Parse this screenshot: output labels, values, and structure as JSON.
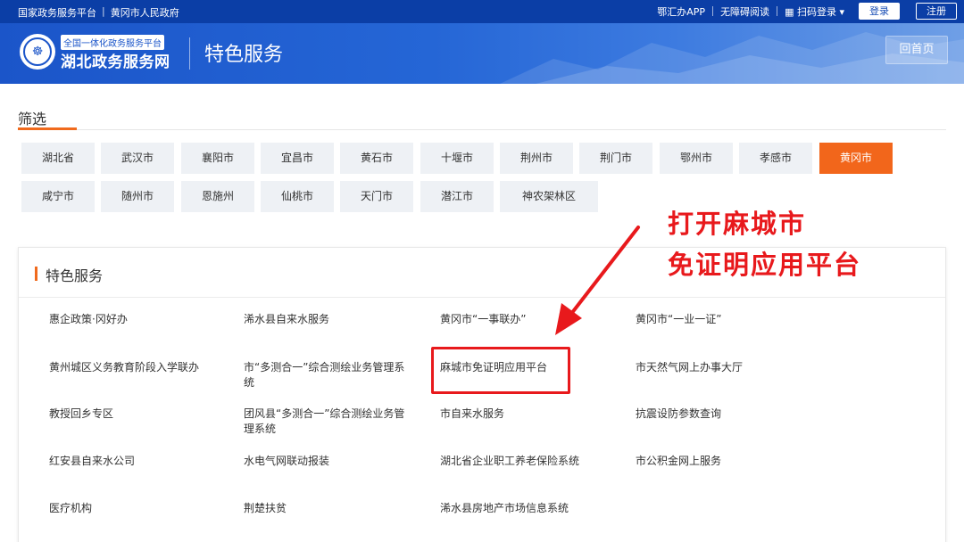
{
  "topbar": {
    "links_left": [
      "国家政务服务平台",
      "黄冈市人民政府"
    ],
    "app_link": "鄂汇办APP",
    "accessible": "无障碍阅读",
    "scan_login": "扫码登录",
    "login": "登录",
    "register": "注册"
  },
  "header": {
    "logo_glyph": "☸",
    "brand_sub": "全国一体化政务服务平台",
    "brand_main": "湖北政务服务网",
    "page_title": "特色服务",
    "home_button": "回首页"
  },
  "filter": {
    "title": "筛选",
    "cities": [
      "湖北省",
      "武汉市",
      "襄阳市",
      "宜昌市",
      "黄石市",
      "十堰市",
      "荆州市",
      "荆门市",
      "鄂州市",
      "孝感市",
      "黄冈市",
      "咸宁市",
      "随州市",
      "恩施州",
      "仙桃市",
      "天门市",
      "潜江市",
      "神农架林区"
    ],
    "active_city": "黄冈市"
  },
  "services": {
    "title": "特色服务",
    "items": [
      "惠企政策·冈好办",
      "浠水县自来水服务",
      "黄冈市“一事联办”",
      "黄冈市“一业一证”",
      "黄州城区义务教育阶段入学联办",
      "市“多测合一”综合测绘业务管理系统",
      "麻城市免证明应用平台",
      "市天然气网上办事大厅",
      "教授回乡专区",
      "团风县“多测合一”综合测绘业务管理系统",
      "市自来水服务",
      "抗震设防参数查询",
      "红安县自来水公司",
      "水电气网联动报装",
      "湖北省企业职工养老保险系统",
      "市公积金网上服务",
      "医疗机构",
      "荆楚扶贫",
      "浠水县房地产市场信息系统"
    ]
  },
  "annotation": {
    "line1": "打开麻城市",
    "line2": "免证明应用平台",
    "color": "#e8191c"
  },
  "colors": {
    "topbar": "#0b3ea6",
    "header": "#1b55c9",
    "accent": "#f2661b"
  }
}
